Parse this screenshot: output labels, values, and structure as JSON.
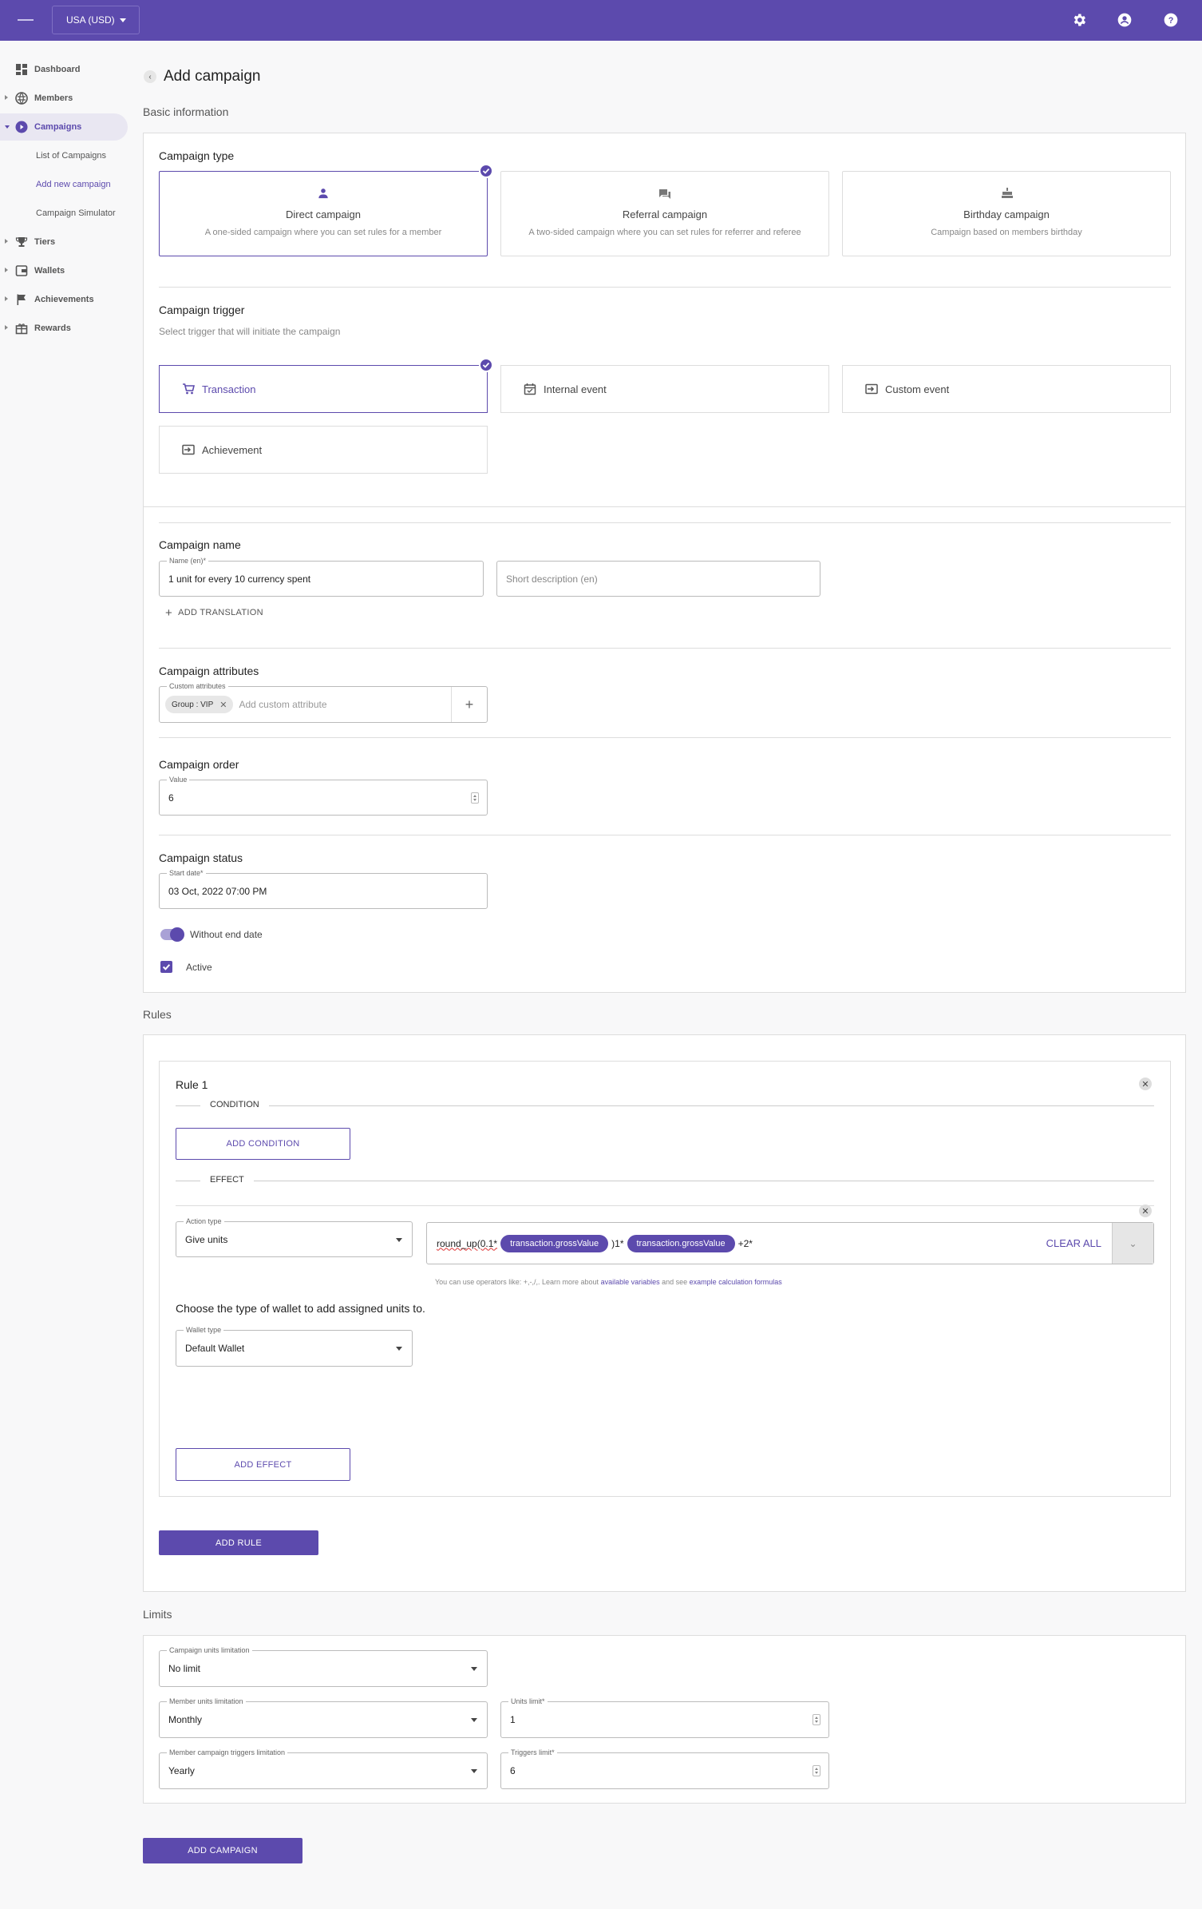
{
  "topbar": {
    "currency": "USA (USD)",
    "icons": [
      "settings-icon",
      "account-icon",
      "help-icon"
    ]
  },
  "sidebar": {
    "items": [
      {
        "label": "Dashboard"
      },
      {
        "label": "Members"
      },
      {
        "label": "Campaigns"
      },
      {
        "label": "Tiers"
      },
      {
        "label": "Wallets"
      },
      {
        "label": "Achievements"
      },
      {
        "label": "Rewards"
      }
    ],
    "subitems": [
      {
        "label": "List of Campaigns"
      },
      {
        "label": "Add new campaign"
      },
      {
        "label": "Campaign Simulator"
      }
    ]
  },
  "page": {
    "title": "Add campaign",
    "basic_info": "Basic information",
    "rules_title": "Rules",
    "limits_title": "Limits",
    "add_campaign_label": "ADD CAMPAIGN"
  },
  "campaign_type": {
    "title": "Campaign type",
    "options": [
      {
        "title": "Direct campaign",
        "desc": "A one-sided campaign where you can set rules for a member"
      },
      {
        "title": "Referral campaign",
        "desc": "A two-sided campaign where you can set rules for referrer and referee"
      },
      {
        "title": "Birthday campaign",
        "desc": "Campaign based on members birthday"
      }
    ]
  },
  "trigger": {
    "title": "Campaign trigger",
    "subtitle": "Select trigger that will initiate the campaign",
    "options": [
      {
        "label": "Transaction"
      },
      {
        "label": "Internal event"
      },
      {
        "label": "Custom event"
      },
      {
        "label": "Achievement"
      }
    ]
  },
  "name": {
    "title": "Campaign name",
    "label": "Name (en)*",
    "value": "1 unit for every 10 currency spent",
    "desc_placeholder": "Short description (en)",
    "add_translation": "ADD TRANSLATION"
  },
  "attributes": {
    "title": "Campaign attributes",
    "label": "Custom attributes",
    "chip": "Group : VIP",
    "placeholder": "Add custom attribute"
  },
  "order": {
    "title": "Campaign order",
    "label": "Value",
    "value": "6"
  },
  "status": {
    "title": "Campaign status",
    "start_label": "Start date*",
    "start_value": "03 Oct, 2022 07:00 PM",
    "no_end_label": "Without end date",
    "active_label": "Active"
  },
  "rule": {
    "title": "Rule 1",
    "condition_legend": "CONDITION",
    "add_condition": "ADD CONDITION",
    "effect_legend": "EFFECT",
    "action_label": "Action type",
    "action_value": "Give units",
    "formula_prefix": "round_up(0.1*",
    "formula_chip1": "transaction.grossValue",
    "formula_mid": ")1*",
    "formula_chip2": "transaction.grossValue",
    "formula_suffix": "+2*",
    "clear_all": "CLEAR ALL",
    "hint_pre": "You can use operators like: +,-,/,. Learn more about",
    "hint_link1": "available variables",
    "hint_mid": "and see",
    "hint_link2": "example calculation formulas",
    "wallet_question": "Choose the type of wallet to add assigned units to.",
    "wallet_label": "Wallet type",
    "wallet_value": "Default Wallet",
    "add_effect": "ADD EFFECT",
    "add_rule": "ADD RULE"
  },
  "limits": {
    "campaign_units_label": "Campaign units limitation",
    "campaign_units_value": "No limit",
    "member_units_label": "Member units limitation",
    "member_units_value": "Monthly",
    "units_limit_label": "Units limit*",
    "units_limit_value": "1",
    "triggers_label": "Member campaign triggers limitation",
    "triggers_value": "Yearly",
    "triggers_limit_label": "Triggers limit*",
    "triggers_limit_value": "6"
  },
  "colors": {
    "brand": "#5c4aad",
    "background": "#f8f8f9"
  }
}
